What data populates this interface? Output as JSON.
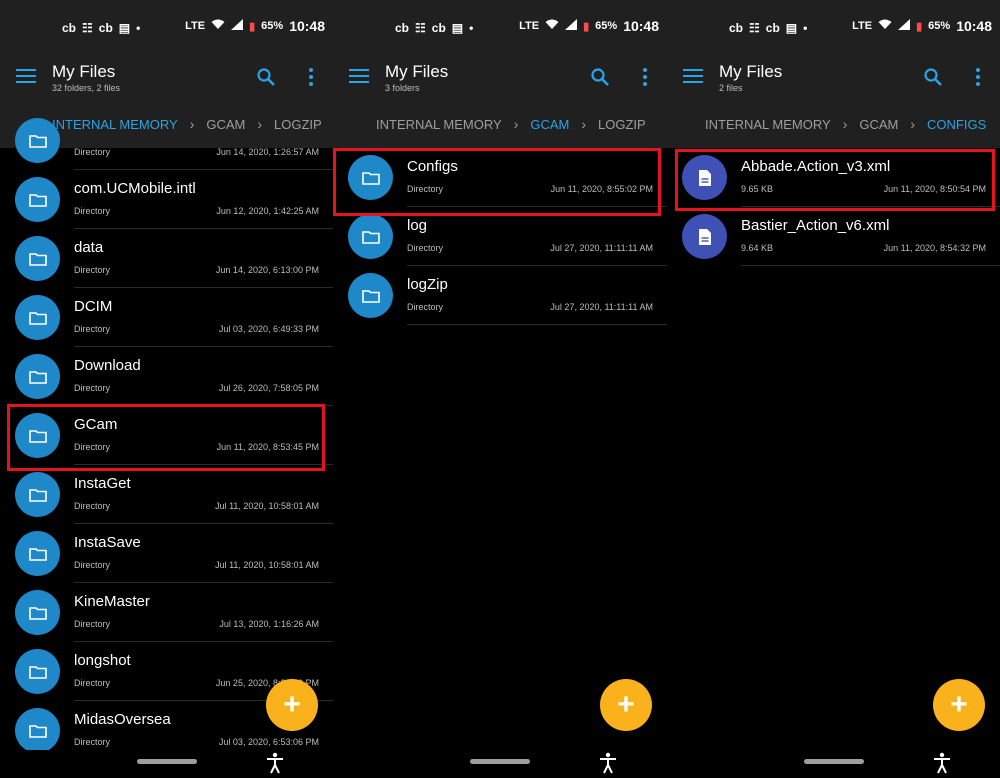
{
  "status_bar": {
    "left_icons": [
      "cb",
      "☷",
      "cb",
      "▤",
      "•"
    ],
    "signal": "LTE",
    "battery": "65%",
    "time": "10:48"
  },
  "panels": [
    {
      "title": "My Files",
      "subtitle": "32 folders, 2 files",
      "breadcrumbs": [
        {
          "label": "INTERNAL MEMORY",
          "active": true
        },
        {
          "label": "GCAM",
          "active": false
        },
        {
          "label": "LOGZIP",
          "active": false
        }
      ],
      "rows": [
        {
          "name": "",
          "meta": "Directory",
          "date": "Jun 14, 2020, 1:26:57 AM",
          "icon": "folder-icon"
        },
        {
          "name": "com.UCMobile.intl",
          "meta": "Directory",
          "date": "Jun 12, 2020, 1:42:25 AM",
          "icon": "folder-icon"
        },
        {
          "name": "data",
          "meta": "Directory",
          "date": "Jun 14, 2020, 6:13:00 PM",
          "icon": "folder-icon"
        },
        {
          "name": "DCIM",
          "meta": "Directory",
          "date": "Jul 03, 2020, 6:49:33 PM",
          "icon": "folder-icon"
        },
        {
          "name": "Download",
          "meta": "Directory",
          "date": "Jul 26, 2020, 7:58:05 PM",
          "icon": "folder-icon"
        },
        {
          "name": "GCam",
          "meta": "Directory",
          "date": "Jun 11, 2020, 8:53:45 PM",
          "icon": "folder-icon"
        },
        {
          "name": "InstaGet",
          "meta": "Directory",
          "date": "Jul 11, 2020, 10:58:01 AM",
          "icon": "folder-icon"
        },
        {
          "name": "InstaSave",
          "meta": "Directory",
          "date": "Jul 11, 2020, 10:58:01 AM",
          "icon": "folder-icon"
        },
        {
          "name": "KineMaster",
          "meta": "Directory",
          "date": "Jul 13, 2020, 1:16:26 AM",
          "icon": "folder-icon"
        },
        {
          "name": "longshot",
          "meta": "Directory",
          "date": "Jun 25, 2020, 8:34:59 PM",
          "icon": "folder-icon"
        },
        {
          "name": "MidasOversea",
          "meta": "Directory",
          "date": "Jul 03, 2020, 6:53:06 PM",
          "icon": "folder-icon"
        }
      ]
    },
    {
      "title": "My Files",
      "subtitle": "3 folders",
      "breadcrumbs": [
        {
          "label": "INTERNAL MEMORY",
          "active": false
        },
        {
          "label": "GCAM",
          "active": true
        },
        {
          "label": "LOGZIP",
          "active": false
        }
      ],
      "rows": [
        {
          "name": "Configs",
          "meta": "Directory",
          "date": "Jun 11, 2020, 8:55:02 PM",
          "icon": "folder-icon"
        },
        {
          "name": "log",
          "meta": "Directory",
          "date": "Jul 27, 2020, 11:11:11 AM",
          "icon": "folder-icon"
        },
        {
          "name": "logZip",
          "meta": "Directory",
          "date": "Jul 27, 2020, 11:11:11 AM",
          "icon": "folder-icon"
        }
      ]
    },
    {
      "title": "My Files",
      "subtitle": "2 files",
      "breadcrumbs": [
        {
          "label": "INTERNAL MEMORY",
          "active": false
        },
        {
          "label": "GCAM",
          "active": false
        },
        {
          "label": "CONFIGS",
          "active": true
        }
      ],
      "rows": [
        {
          "name": "Abbade.Action_v3.xml",
          "meta": "9.65 KB",
          "date": "Jun 11, 2020, 8:50:54 PM",
          "icon": "file-icon"
        },
        {
          "name": "Bastier_Action_v6.xml",
          "meta": "9.64 KB",
          "date": "Jun 11, 2020, 8:54:32 PM",
          "icon": "file-icon"
        }
      ]
    }
  ],
  "fab_label": "+",
  "colors": {
    "accent": "#2aa3e8",
    "folder_badge": "#1e88c8",
    "file_badge": "#3f51b5",
    "fab": "#f9b21b",
    "highlight": "#e3141d",
    "bar_bg": "#202020"
  }
}
